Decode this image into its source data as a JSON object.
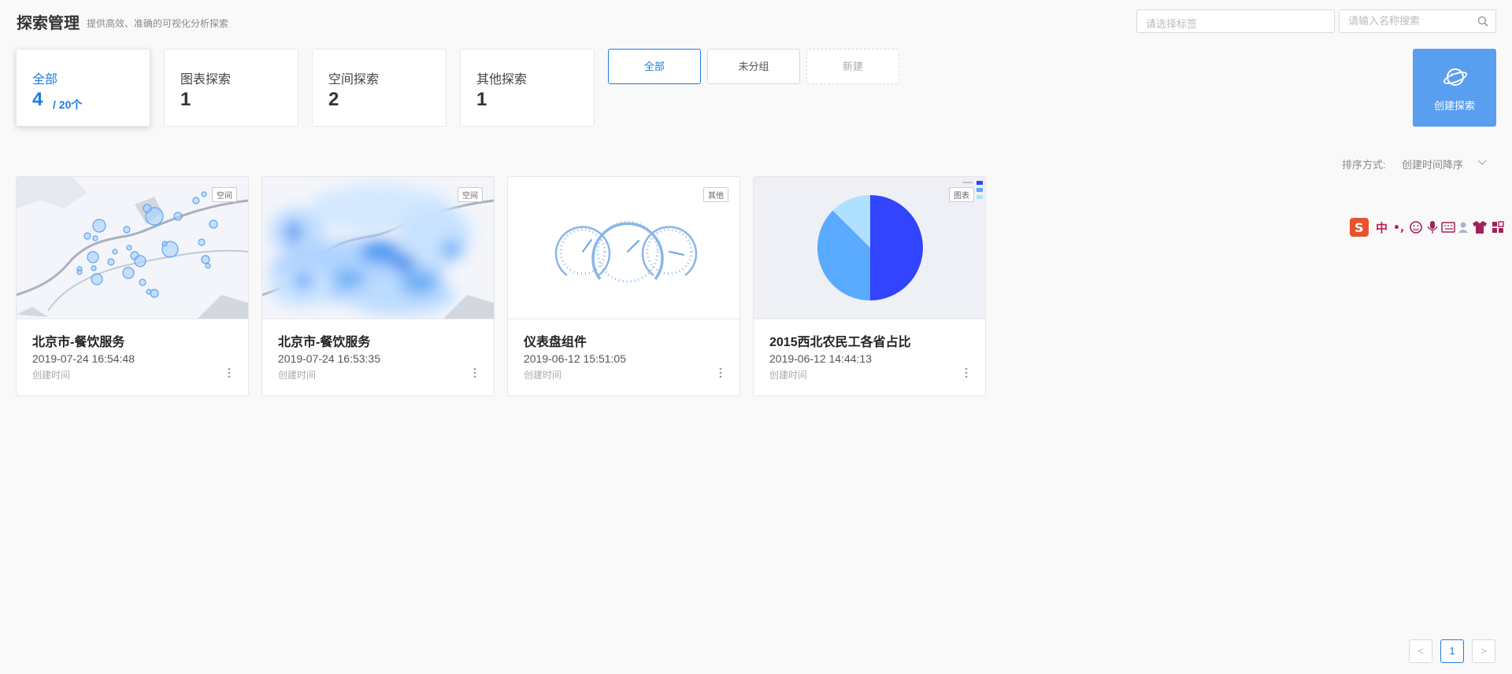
{
  "header": {
    "title": "探索管理",
    "subtitle": "提供高效、准确的可视化分析探索",
    "tag_select_placeholder": "请选择标签",
    "search_placeholder": "请输入名称搜索"
  },
  "stats": [
    {
      "label": "全部",
      "count": "4",
      "total": "/ 20个"
    },
    {
      "label": "图表探索",
      "count": "1"
    },
    {
      "label": "空间探索",
      "count": "2"
    },
    {
      "label": "其他探索",
      "count": "1"
    }
  ],
  "groups": [
    "全部",
    "未分组",
    "新建"
  ],
  "create_button": "创建探索",
  "sort": {
    "label": "排序方式:",
    "value": "创建时间降序"
  },
  "cards": [
    {
      "title": "北京市-餐饮服务",
      "date": "2019-07-24 16:54:48",
      "date_label": "创建时间",
      "badge": "空间"
    },
    {
      "title": "北京市-餐饮服务",
      "date": "2019-07-24 16:53:35",
      "date_label": "创建时间",
      "badge": "空间"
    },
    {
      "title": "仪表盘组件",
      "date": "2019-06-12 15:51:05",
      "date_label": "创建时间",
      "badge": "其他"
    },
    {
      "title": "2015西北农民工各省占比",
      "date": "2019-06-12 14:44:13",
      "date_label": "创建时间",
      "badge": "图表"
    }
  ],
  "ime_bar": {
    "mode": "中"
  },
  "pagination": {
    "prev": "<",
    "current": "1",
    "next": ">"
  },
  "colors": {
    "accent": "#1e7ce8",
    "create_button": "#5a9ef0",
    "pie_dark": "#3344ff",
    "pie_mid": "#5aaaff",
    "pie_light": "#b0e0ff"
  }
}
